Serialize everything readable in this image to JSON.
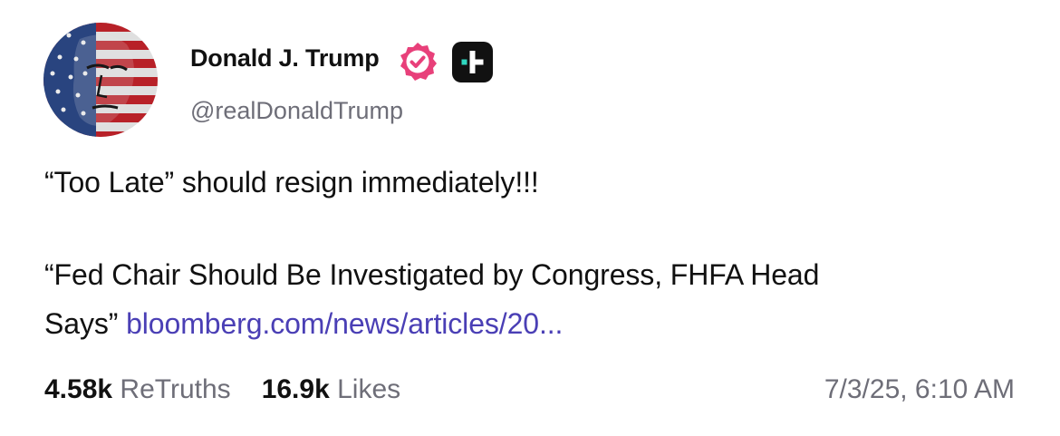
{
  "author": {
    "display_name": "Donald J. Trump",
    "handle": "@realDonaldTrump",
    "verified_badge_color": "#e8407a",
    "badge_icons": [
      "verified-badge-icon",
      "truth-plus-icon"
    ]
  },
  "post": {
    "line_1": "“Too Late” should resign immediately!!!",
    "line_2": "“Fed Chair Should Be Investigated by Congress, FHFA Head",
    "line_3_text": "Says” ",
    "link_text": "bloomberg.com/news/articles/20...",
    "link_color": "#4a3fb5"
  },
  "stats": {
    "retruths_count": "4.58k",
    "retruths_label": "ReTruths",
    "likes_count": "16.9k",
    "likes_label": "Likes"
  },
  "timestamp": "7/3/25, 6:10 AM"
}
